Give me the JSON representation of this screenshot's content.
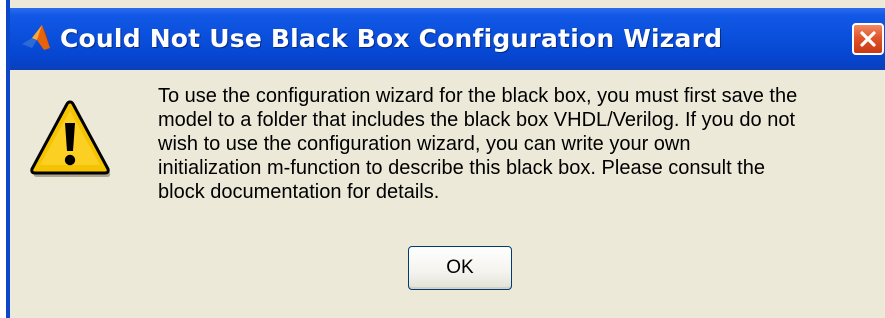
{
  "dialog": {
    "title": "Could Not Use Black Box Configuration Wizard",
    "app_icon": "matlab-logo-icon",
    "close_icon": "close-icon",
    "warning_icon": "warning-icon",
    "message_lines": [
      "To use the configuration wizard for the black box, you must first save the",
      "model to a folder that includes the black box VHDL/Verilog.  If you do not",
      "wish to use the configuration wizard, you can write your own",
      "initialization m-function to describe this black box. Please consult the",
      "block documentation for details."
    ],
    "ok_label": "OK"
  },
  "colors": {
    "titlebar": "#0a50dc",
    "window_border": "#0b47c8",
    "dialog_background": "#ece9d8",
    "close_button": "#e2542a",
    "warning_fill": "#f5c400"
  }
}
